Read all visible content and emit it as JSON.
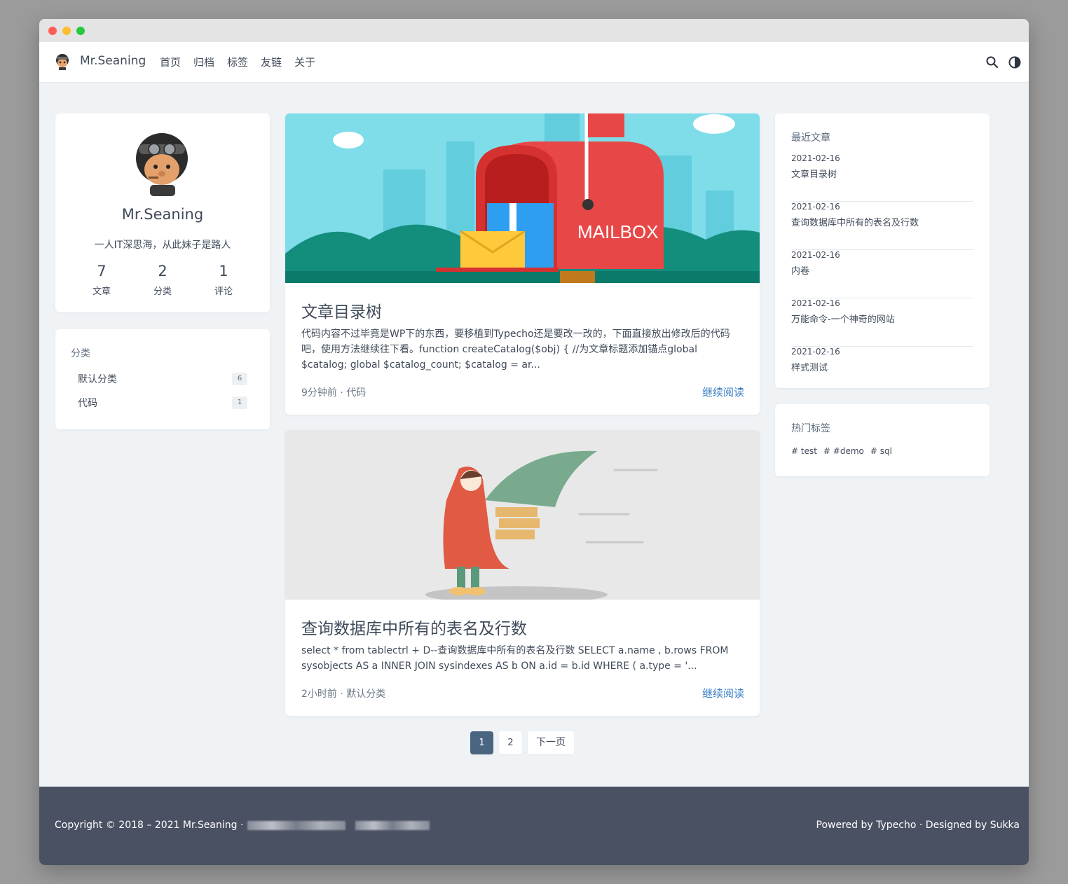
{
  "navbar": {
    "brand": "Mr.Seaning",
    "links": [
      "首页",
      "归档",
      "标签",
      "友链",
      "关于"
    ]
  },
  "profile": {
    "name": "Mr.Seaning",
    "bio": "一人IT深思海，从此妹子是路人",
    "stats": [
      {
        "value": "7",
        "label": "文章"
      },
      {
        "value": "2",
        "label": "分类"
      },
      {
        "value": "1",
        "label": "评论"
      }
    ]
  },
  "categories": {
    "title": "分类",
    "items": [
      {
        "name": "默认分类",
        "count": "6"
      },
      {
        "name": "代码",
        "count": "1"
      }
    ]
  },
  "posts": [
    {
      "cover_text": "MAILBOX",
      "title": "文章目录树",
      "excerpt": "代码内容不过毕竟是WP下的东西，要移植到Typecho还是要改一改的，下面直接放出修改后的代码吧，使用方法继续往下看。function createCatalog($obj) { //为文章标题添加锚点global $catalog; global $catalog_count; $catalog = ar...",
      "time": "9分钟前",
      "category": "代码",
      "read_more": "继续阅读"
    },
    {
      "title": "查询数据库中所有的表名及行数",
      "excerpt": "select * from tablectrl + D--查询数据库中所有的表名及行数 SELECT a.name , b.rows FROM sysobjects AS a INNER JOIN sysindexes AS b ON a.id = b.id WHERE ( a.type = '...",
      "time": "2小时前",
      "category": "默认分类",
      "read_more": "继续阅读"
    }
  ],
  "pagination": {
    "pages": [
      "1",
      "2"
    ],
    "next": "下一页",
    "current": "1"
  },
  "recent": {
    "title": "最近文章",
    "items": [
      {
        "date": "2021-02-16",
        "title": "文章目录树"
      },
      {
        "date": "2021-02-16",
        "title": "查询数据库中所有的表名及行数"
      },
      {
        "date": "2021-02-16",
        "title": "内卷"
      },
      {
        "date": "2021-02-16",
        "title": "万能命令-一个神奇的网站"
      },
      {
        "date": "2021-02-16",
        "title": "样式测试"
      }
    ]
  },
  "tags": {
    "title": "热门标签",
    "items": [
      "# test",
      "# #demo",
      "# sql"
    ]
  },
  "footer": {
    "copyright": "Copyright © 2018 – 2021 Mr.Seaning ·",
    "powered": "Powered by Typecho · Designed by Sukka"
  },
  "colors": {
    "accent": "#3b80c3",
    "footer_bg": "#4a5163",
    "page_active": "#4a6580"
  },
  "icons": [
    "search-icon",
    "theme-toggle-icon"
  ]
}
